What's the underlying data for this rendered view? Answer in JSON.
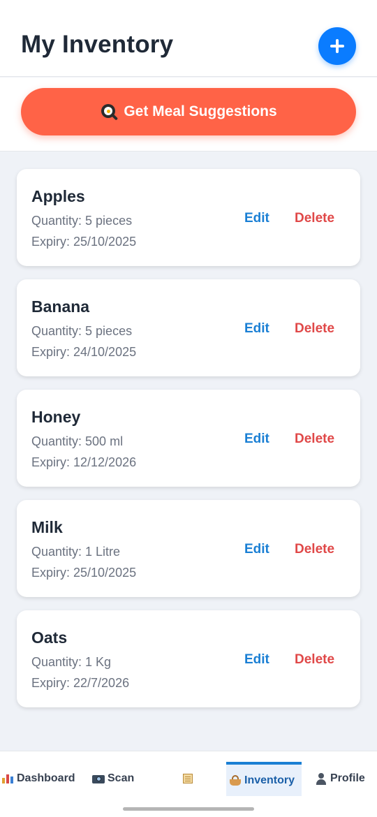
{
  "status_mark": "📶 ◔ ▾",
  "header": {
    "title": "My Inventory",
    "add_icon": "plus-icon"
  },
  "cta": {
    "label": "Get Meal Suggestions",
    "icon": "frying-pan-egg-icon"
  },
  "items": [
    {
      "name": "Apples",
      "quantity": "Quantity: 5 pieces",
      "expiry": "Expiry: 25/10/2025",
      "edit": "Edit",
      "delete": "Delete"
    },
    {
      "name": "Banana",
      "quantity": "Quantity: 5 pieces",
      "expiry": "Expiry: 24/10/2025",
      "edit": "Edit",
      "delete": "Delete"
    },
    {
      "name": "Honey",
      "quantity": "Quantity: 500 ml",
      "expiry": "Expiry: 12/12/2026",
      "edit": "Edit",
      "delete": "Delete"
    },
    {
      "name": "Milk",
      "quantity": "Quantity: 1 Litre",
      "expiry": "Expiry: 25/10/2025",
      "edit": "Edit",
      "delete": "Delete"
    },
    {
      "name": "Oats",
      "quantity": "Quantity: 1 Kg",
      "expiry": "Expiry: 22/7/2026",
      "edit": "Edit",
      "delete": "Delete"
    }
  ],
  "tabs": [
    {
      "label": "Dashboard",
      "icon": "bar-chart-icon"
    },
    {
      "label": "Scan",
      "icon": "camera-icon"
    },
    {
      "label": "",
      "icon": "scroll-icon"
    },
    {
      "label": "Inventory",
      "icon": "basket-icon",
      "active": true
    },
    {
      "label": "Profile",
      "icon": "person-icon"
    }
  ],
  "colors": {
    "accent": "#0a7cff",
    "cta": "#ff6347",
    "edit": "#1a7fd4",
    "delete": "#e04848",
    "background": "#eff2f7"
  }
}
